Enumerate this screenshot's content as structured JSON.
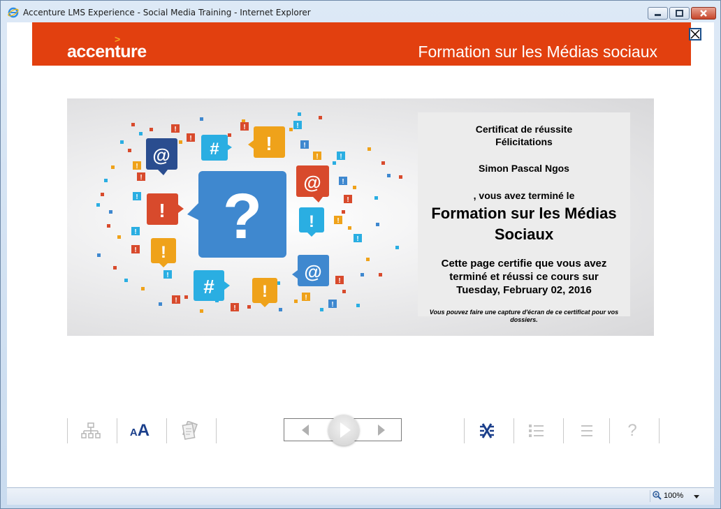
{
  "window": {
    "title": "Accenture LMS Experience - Social Media Training - Internet Explorer"
  },
  "header": {
    "logo": "accenture",
    "logo_accent": ">",
    "title": "Formation sur les Médias sociaux",
    "colors": {
      "header_bg": "#e2400f",
      "logo_accent": "#f5a623"
    }
  },
  "banner": {
    "illustration": {
      "main_icon": "question-mark",
      "symbols": [
        "@",
        "#",
        "!"
      ],
      "colors": {
        "blue": "#3f88cf",
        "navy": "#2a4d8f",
        "red": "#d84a2c",
        "orange": "#efa21a",
        "cyan": "#2aaee2"
      }
    }
  },
  "certificate": {
    "line1": "Certificat de réussite",
    "line2": "Félicitations",
    "name": "Simon Pascal Ngos",
    "completed": ", vous avez terminé le",
    "course_line1": "Formation sur les Médias",
    "course_line2": "Sociaux",
    "certifies_line1": "Cette page certifie que vous avez",
    "certifies_line2": "terminé et réussi ce cours sur",
    "date": "Tuesday, February 02, 2016",
    "note_line1": "Vous pouvez faire une capture d'écran de ce certificat pour vos",
    "note_line2": "dossiers."
  },
  "toolbar": {
    "left_icons": [
      "sitemap-icon",
      "font-size-icon",
      "notes-icon"
    ],
    "font_size_small": "A",
    "font_size_large": "A",
    "right_icons": [
      "glossary-icon",
      "list-icon",
      "menu-icon",
      "help-icon"
    ],
    "help_symbol": "?"
  },
  "statusbar": {
    "zoom": "100%"
  }
}
